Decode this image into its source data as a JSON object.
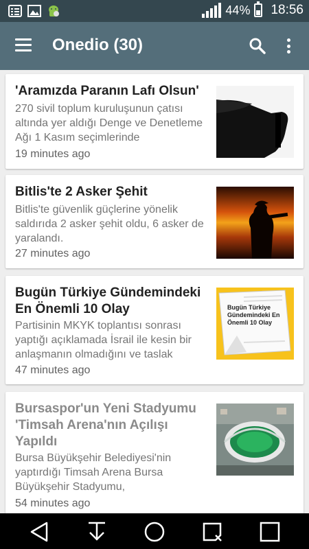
{
  "status": {
    "battery": "44%",
    "time": "18:56"
  },
  "appbar": {
    "title": "Onedio (30)"
  },
  "articles": [
    {
      "title": "'Aramızda Paranın Lafı Olsun'",
      "description": "270 sivil toplum kuruluşunun çatısı altında yer aldığı Denge ve Denetleme Ağı 1 Kasım seçimlerinde",
      "time": "19 minutes ago"
    },
    {
      "title": "Bitlis'te 2 Asker Şehit",
      "description": "Bitlis'te güvenlik güçlerine yönelik saldırıda 2 asker şehit oldu, 6 asker de yaralandı.",
      "time": "27 minutes ago"
    },
    {
      "title": "Bugün Türkiye Gündemindeki En Önemli 10 Olay",
      "description": "Partisinin MKYK toplantısı sonrası yaptığı açıklamada İsrail ile kesin bir anlaşmanın olmadığını ve taslak",
      "time": "47 minutes ago",
      "thumb_text": "Bugün Türkiye Gündemindeki En Önemli 10 Olay"
    },
    {
      "title": "Bursaspor'un Yeni Stadyumu 'Timsah Arena'nın Açılışı Yapıldı",
      "description": "Bursa Büyükşehir Belediyesi'nin yaptırdığı Timsah Arena Bursa Büyükşehir Stadyumu,",
      "time": "54 minutes ago"
    }
  ],
  "colors": {
    "statusbar": "#34474f",
    "appbar": "#546e7a",
    "background": "#eeeeee"
  },
  "icons": [
    "news-icon",
    "image-icon",
    "android-icon",
    "signal-icon",
    "battery-icon",
    "menu-icon",
    "search-icon",
    "more-vert-icon",
    "back-icon",
    "download-icon",
    "home-icon",
    "search-nav-icon",
    "recents-icon"
  ]
}
